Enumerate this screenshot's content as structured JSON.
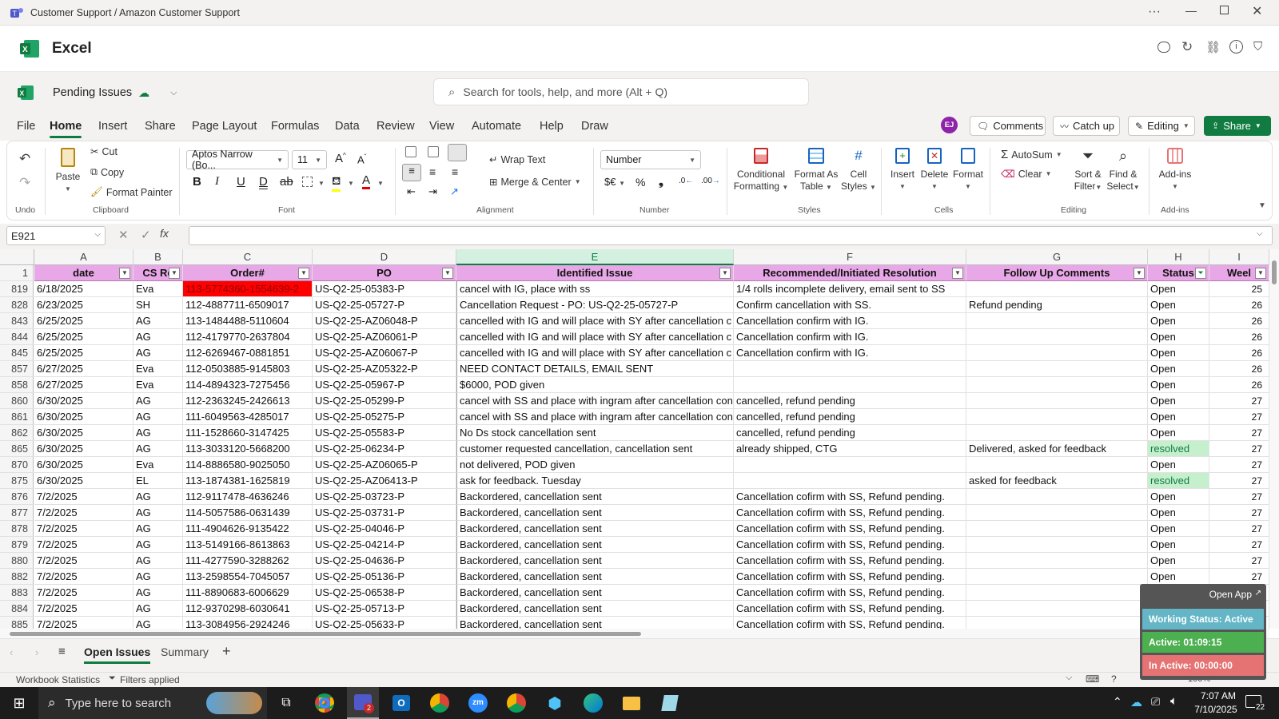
{
  "window": {
    "title": "Customer Support / Amazon Customer Support"
  },
  "app": {
    "name": "Excel"
  },
  "doc": {
    "name": "Pending Issues",
    "search_placeholder": "Search for tools, help, and more (Alt + Q)"
  },
  "menu_tabs": [
    "File",
    "Home",
    "Insert",
    "Share",
    "Page Layout",
    "Formulas",
    "Data",
    "Review",
    "View",
    "Automate",
    "Help",
    "Draw"
  ],
  "active_tab": "Home",
  "topright": {
    "avatar": "EJ",
    "comments": "Comments",
    "catchup": "Catch up",
    "editing": "Editing",
    "share": "Share"
  },
  "ribbon": {
    "undo_group": "Undo",
    "clipboard": {
      "paste": "Paste",
      "cut": "Cut",
      "copy": "Copy",
      "format_painter": "Format Painter",
      "label": "Clipboard"
    },
    "font": {
      "name": "Aptos Narrow (Bo...",
      "size": "11",
      "label": "Font"
    },
    "alignment": {
      "wrap": "Wrap Text",
      "merge": "Merge & Center",
      "label": "Alignment"
    },
    "number": {
      "format": "Number",
      "label": "Number"
    },
    "styles": {
      "cond": "Conditional",
      "cond2": "Formatting",
      "fmt_table": "Format As",
      "fmt_table2": "Table",
      "cell_styles": "Cell",
      "cell_styles2": "Styles",
      "label": "Styles"
    },
    "cells": {
      "insert": "Insert",
      "delete": "Delete",
      "format": "Format",
      "label": "Cells"
    },
    "editing": {
      "autosum": "AutoSum",
      "clear": "Clear",
      "sort": "Sort &",
      "sort2": "Filter",
      "find": "Find &",
      "find2": "Select",
      "label": "Editing"
    },
    "addins": {
      "label1": "Add-ins",
      "label": "Add-ins"
    }
  },
  "namebox": "E921",
  "columns": [
    "A",
    "B",
    "C",
    "D",
    "E",
    "F",
    "G",
    "H",
    "I"
  ],
  "header_row": {
    "num": "1",
    "cells": [
      "date",
      "CS Re",
      "Order#",
      "PO",
      "Identified Issue",
      "Recommended/Initiated Resolution",
      "Follow Up Comments",
      "Status",
      "Weel"
    ]
  },
  "rows": [
    {
      "n": "819",
      "date": "6/18/2025",
      "cs": "Eva",
      "order": "113-5774360-1554639-2",
      "po": "US-Q2-25-05383-P",
      "issue": "cancel with IG, place with ss",
      "res": "1/4 rolls incomplete delivery, email sent to SS",
      "follow": "",
      "status": "Open",
      "week": "25"
    },
    {
      "n": "828",
      "date": "6/23/2025",
      "cs": "SH",
      "order": "112-4887711-6509017",
      "po": "US-Q2-25-05727-P",
      "issue": "Cancellation Request - PO: US-Q2-25-05727-P",
      "res": "Confirm cancellation with SS.",
      "follow": "Refund pending",
      "status": "Open",
      "week": "26"
    },
    {
      "n": "843",
      "date": "6/25/2025",
      "cs": "AG",
      "order": "113-1484488-5110604",
      "po": "US-Q2-25-AZ06048-P",
      "issue": "cancelled with IG and will place with SY after cancellation c",
      "res": "Cancellation confirm with IG.",
      "follow": "",
      "status": "Open",
      "week": "26"
    },
    {
      "n": "844",
      "date": "6/25/2025",
      "cs": "AG",
      "order": "112-4179770-2637804",
      "po": "US-Q2-25-AZ06061-P",
      "issue": "cancelled with IG and will place with SY after cancellation c",
      "res": "Cancellation confirm with IG.",
      "follow": "",
      "status": "Open",
      "week": "26"
    },
    {
      "n": "845",
      "date": "6/25/2025",
      "cs": "AG",
      "order": "112-6269467-0881851",
      "po": "US-Q2-25-AZ06067-P",
      "issue": "cancelled with IG and will place with SY after cancellation c",
      "res": "Cancellation confirm with IG.",
      "follow": "",
      "status": "Open",
      "week": "26"
    },
    {
      "n": "857",
      "date": "6/27/2025",
      "cs": "Eva",
      "order": "112-0503885-9145803",
      "po": "US-Q2-25-AZ05322-P",
      "issue": "NEED CONTACT DETAILS, EMAIL SENT",
      "res": "",
      "follow": "",
      "status": "Open",
      "week": "26"
    },
    {
      "n": "858",
      "date": "6/27/2025",
      "cs": "Eva",
      "order": "114-4894323-7275456",
      "po": " US-Q2-25-05967-P",
      "issue": "$6000, POD given",
      "res": "",
      "follow": "",
      "status": "Open",
      "week": "26"
    },
    {
      "n": "860",
      "date": "6/30/2025",
      "cs": "AG",
      "order": "112-2363245-2426613",
      "po": "US-Q2-25-05299-P",
      "issue": "cancel with SS and place with ingram after cancellation con",
      "res": "cancelled, refund pending",
      "follow": "",
      "status": "Open",
      "week": "27"
    },
    {
      "n": "861",
      "date": "6/30/2025",
      "cs": "AG",
      "order": "111-6049563-4285017",
      "po": "US-Q2-25-05275-P",
      "issue": "cancel with SS and place with ingram after cancellation con",
      "res": "cancelled, refund pending",
      "follow": "",
      "status": "Open",
      "week": "27"
    },
    {
      "n": "862",
      "date": "6/30/2025",
      "cs": "AG",
      "order": "111-1528660-3147425",
      "po": "US-Q2-25-05583-P",
      "issue": "No Ds stock cancellation sent",
      "res": "cancelled, refund pending",
      "follow": "",
      "status": "Open",
      "week": "27"
    },
    {
      "n": "865",
      "date": "6/30/2025",
      "cs": "AG",
      "order": "113-3033120-5668200",
      "po": "US-Q2-25-06234-P",
      "issue": "customer requested cancellation, cancellation sent",
      "res": "already shipped, CTG",
      "follow": "Delivered, asked for feedback",
      "status": "resolved",
      "week": "27"
    },
    {
      "n": "870",
      "date": "6/30/2025",
      "cs": "Eva",
      "order": "114-8886580-9025050",
      "po": "US-Q2-25-AZ06065-P",
      "issue": "not delivered, POD given",
      "res": "",
      "follow": "",
      "status": "Open",
      "week": "27"
    },
    {
      "n": "875",
      "date": "6/30/2025",
      "cs": "EL",
      "order": "113-1874381-1625819",
      "po": "US-Q2-25-AZ06413-P",
      "issue": "ask for feedback. Tuesday",
      "res": "",
      "follow": "asked for feedback",
      "status": "resolved",
      "week": "27"
    },
    {
      "n": "876",
      "date": "7/2/2025",
      "cs": "AG",
      "order": "112-9117478-4636246",
      "po": "US-Q2-25-03723-P",
      "issue": "Backordered, cancellation sent",
      "res": "Cancellation cofirm with SS, Refund pending.",
      "follow": "",
      "status": "Open",
      "week": "27"
    },
    {
      "n": "877",
      "date": "7/2/2025",
      "cs": "AG",
      "order": "114-5057586-0631439",
      "po": "US-Q2-25-03731-P",
      "issue": "Backordered, cancellation sent",
      "res": "Cancellation cofirm with SS, Refund pending.",
      "follow": "",
      "status": "Open",
      "week": "27"
    },
    {
      "n": "878",
      "date": "7/2/2025",
      "cs": "AG",
      "order": "111-4904626-9135422",
      "po": "US-Q2-25-04046-P",
      "issue": "Backordered, cancellation sent",
      "res": "Cancellation cofirm with SS, Refund pending.",
      "follow": "",
      "status": "Open",
      "week": "27"
    },
    {
      "n": "879",
      "date": "7/2/2025",
      "cs": "AG",
      "order": "113-5149166-8613863",
      "po": "US-Q2-25-04214-P",
      "issue": "Backordered, cancellation sent",
      "res": "Cancellation cofirm with SS, Refund pending.",
      "follow": "",
      "status": "Open",
      "week": "27"
    },
    {
      "n": "880",
      "date": "7/2/2025",
      "cs": "AG",
      "order": "111-4277590-3288262",
      "po": "US-Q2-25-04636-P",
      "issue": "Backordered, cancellation sent",
      "res": "Cancellation cofirm with SS, Refund pending.",
      "follow": "",
      "status": "Open",
      "week": "27"
    },
    {
      "n": "882",
      "date": "7/2/2025",
      "cs": "AG",
      "order": "113-2598554-7045057",
      "po": "US-Q2-25-05136-P",
      "issue": "Backordered, cancellation sent",
      "res": "Cancellation cofirm with SS, Refund pending.",
      "follow": "",
      "status": "Open",
      "week": "27"
    },
    {
      "n": "883",
      "date": "7/2/2025",
      "cs": "AG",
      "order": "111-8890683-6006629",
      "po": "US-Q2-25-06538-P",
      "issue": "Backordered, cancellation sent",
      "res": "Cancellation cofirm with SS, Refund pending.",
      "follow": "",
      "status": "Open",
      "week": "27"
    },
    {
      "n": "884",
      "date": "7/2/2025",
      "cs": "AG",
      "order": "112-9370298-6030641",
      "po": "US-Q2-25-05713-P",
      "issue": "Backordered, cancellation sent",
      "res": "Cancellation cofirm with SS, Refund pending.",
      "follow": "",
      "status": "Open",
      "week": "27"
    },
    {
      "n": "885",
      "date": "7/2/2025",
      "cs": "AG",
      "order": "113-3084956-2924246",
      "po": "US-Q2-25-05633-P",
      "issue": "Backordered, cancellation sent",
      "res": "Cancellation cofirm with SS, Refund pending.",
      "follow": "",
      "status": "Open",
      "week": "27"
    }
  ],
  "sheets": [
    "Open Issues",
    "Summary"
  ],
  "active_sheet": "Open Issues",
  "status": {
    "workbook": "Workbook Statistics",
    "filters": "Filters applied",
    "zoom": "100%"
  },
  "widget": {
    "open_app": "Open App",
    "working": "Working Status: Active",
    "active": "Active: 01:09:15",
    "inactive": "In Active: 00:00:00"
  },
  "taskbar": {
    "search": "Type here to search",
    "time": "7:07 AM",
    "date": "7/10/2025",
    "notif": "22",
    "teams_badge": "2"
  }
}
